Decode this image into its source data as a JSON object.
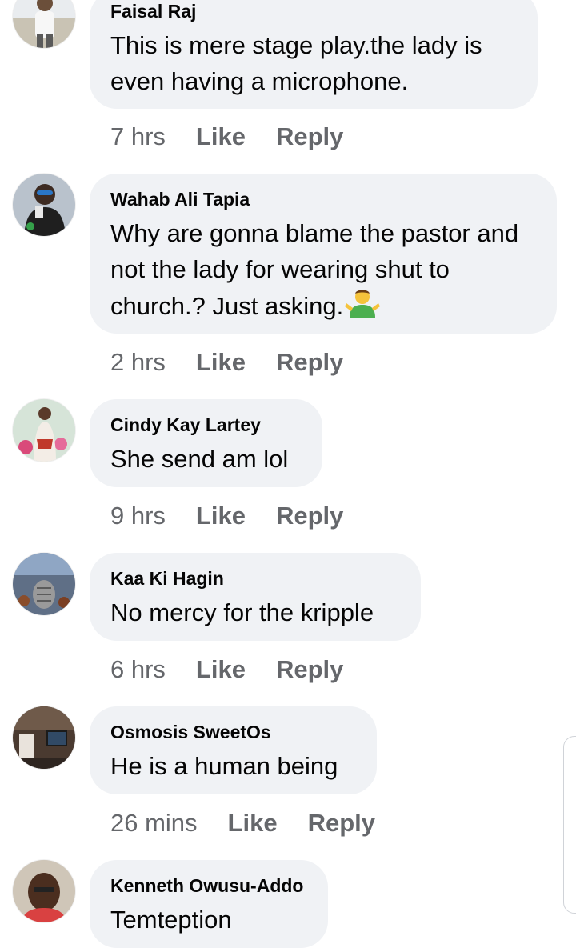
{
  "comments": [
    {
      "author": "Faisal Raj",
      "text": "This is mere stage play.the lady is even having a microphone.",
      "time": "7 hrs",
      "like": "Like",
      "reply": "Reply",
      "avatar_icon": "person-photo-avatar"
    },
    {
      "author": "Wahab Ali Tapia",
      "text": "Why are gonna blame the pastor and not the lady for wearing shut to church.?  Just asking.",
      "time": "2 hrs",
      "like": "Like",
      "reply": "Reply",
      "emoji_icon": "man-shrugging-emoji",
      "avatar_icon": "person-photo-avatar"
    },
    {
      "author": "Cindy Kay Lartey",
      "text": "She send am lol",
      "time": "9 hrs",
      "like": "Like",
      "reply": "Reply",
      "avatar_icon": "person-photo-avatar"
    },
    {
      "author": "Kaa Ki Hagin",
      "text": "No mercy for the kripple",
      "time": "6 hrs",
      "like": "Like",
      "reply": "Reply",
      "avatar_icon": "microphone-photo-avatar"
    },
    {
      "author": "Osmosis SweetOs",
      "text": "He is a human being",
      "time": "26 mins",
      "like": "Like",
      "reply": "Reply",
      "avatar_icon": "room-photo-avatar"
    },
    {
      "author": "Kenneth Owusu-Addo",
      "text": "Temteption",
      "time": "",
      "like": "",
      "reply": "",
      "avatar_icon": "person-photo-avatar"
    }
  ],
  "colors": {
    "bubble": "#f0f2f5",
    "author": "#050505",
    "meta": "#65676b"
  }
}
